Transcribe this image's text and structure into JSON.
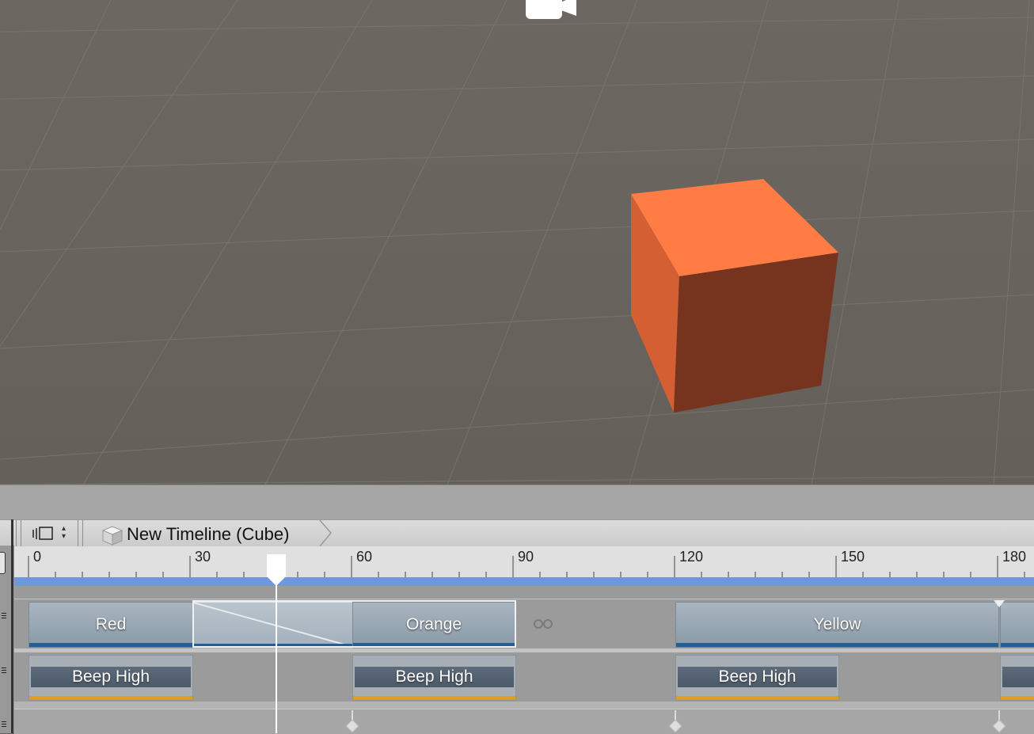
{
  "scene": {
    "background_color": "#69625c",
    "object_color": "#ff7a45",
    "camera_icon": "camera-gizmo-icon"
  },
  "toolbar": {
    "view_toggle_icon": "track-view-icon",
    "sort_icon": "up-down-arrows-icon",
    "breadcrumb_label": "New Timeline (Cube)",
    "breadcrumb_icon": "cube-icon"
  },
  "ruler": {
    "ticks": [
      "0",
      "30",
      "60",
      "90",
      "120",
      "150",
      "180"
    ]
  },
  "tracks": {
    "animation": {
      "clips": [
        {
          "label": "Red"
        },
        {
          "label": "Orange"
        },
        {
          "label": "Yellow"
        }
      ],
      "loop_icon": "loop-icon"
    },
    "audio": {
      "clips": [
        {
          "label": "Beep High"
        },
        {
          "label": "Beep High"
        },
        {
          "label": "Beep High"
        }
      ]
    }
  },
  "colors": {
    "range_bar": "#6f97dc",
    "anim_underline": "#245d97",
    "audio_underline": "#e59a22",
    "playhead": "#ffffff"
  }
}
